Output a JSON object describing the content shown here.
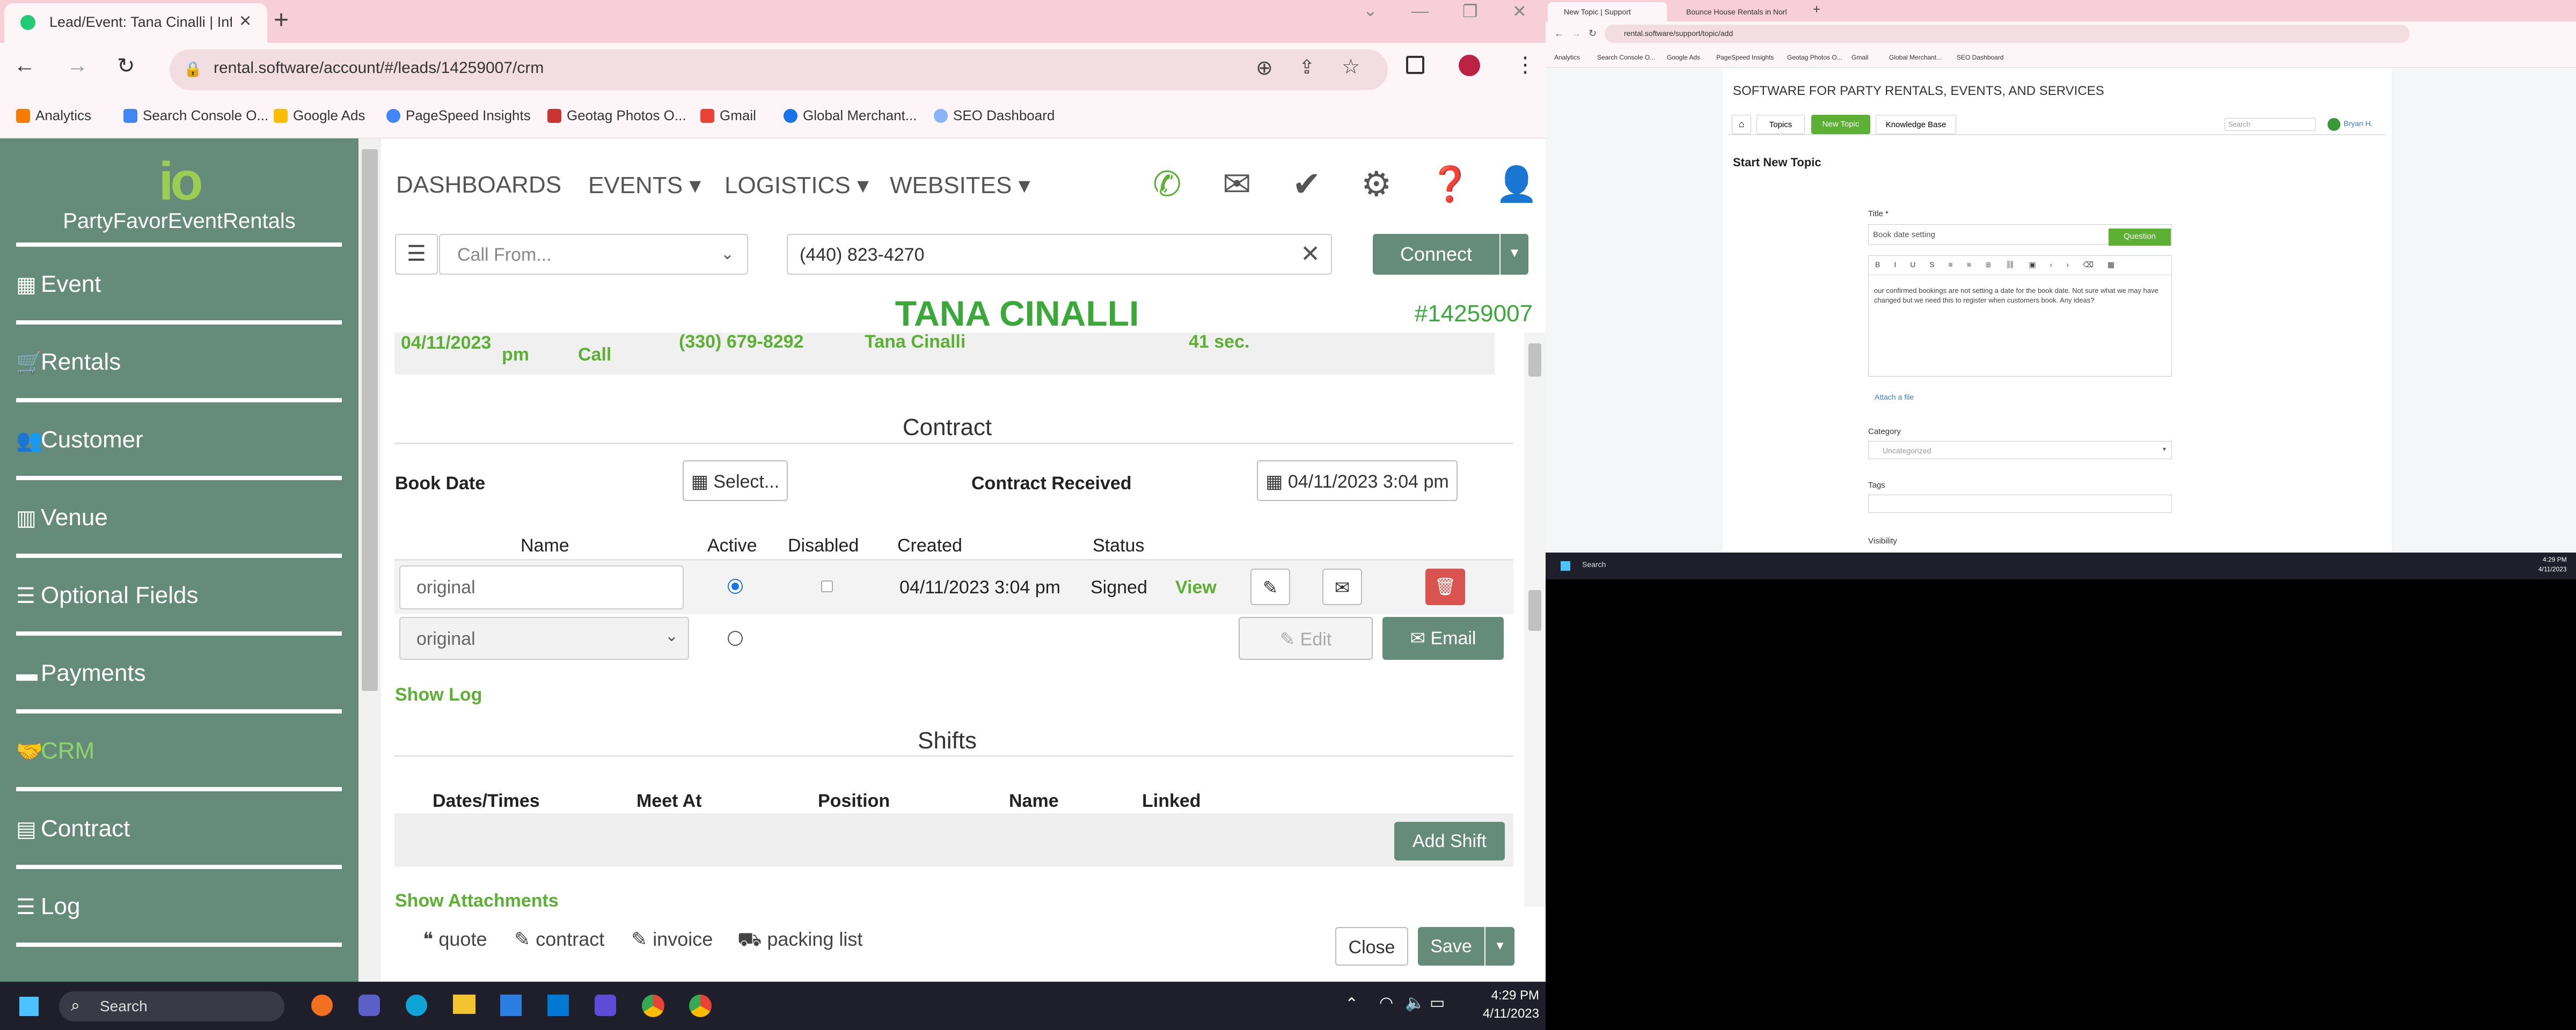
{
  "left_browser": {
    "tab_title": "Lead/Event: Tana Cinalli | Inflat",
    "url": "rental.software/account/#/leads/14259007/crm",
    "bookmarks": [
      "Analytics",
      "Search Console O...",
      "Google Ads",
      "PageSpeed Insights",
      "Geotag Photos O...",
      "Gmail",
      "Global Merchant...",
      "SEO Dashboard"
    ]
  },
  "app": {
    "logo_mark": "io",
    "company": "PartyFavorEventRentals",
    "sidebar": [
      {
        "icon": "calendar-icon",
        "glyph": "▦",
        "label": "Event"
      },
      {
        "icon": "cart-icon",
        "glyph": "🛒",
        "label": "Rentals"
      },
      {
        "icon": "users-icon",
        "glyph": "👥",
        "label": "Customer"
      },
      {
        "icon": "building-icon",
        "glyph": "▥",
        "label": "Venue"
      },
      {
        "icon": "list-icon",
        "glyph": "☰",
        "label": "Optional Fields"
      },
      {
        "icon": "money-icon",
        "glyph": "▬",
        "label": "Payments"
      },
      {
        "icon": "handshake-icon",
        "glyph": "🤝",
        "label": "CRM"
      },
      {
        "icon": "file-icon",
        "glyph": "▤",
        "label": "Contract"
      },
      {
        "icon": "list-icon",
        "glyph": "☰",
        "label": "Log"
      }
    ],
    "nav": [
      "DASHBOARDS",
      "EVENTS ▾",
      "LOGISTICS ▾",
      "WEBSITES ▾"
    ],
    "call": {
      "from_placeholder": "Call From...",
      "number": "(440) 823-4270",
      "connect": "Connect"
    },
    "customer_name": "TANA CINALLI",
    "lead_id": "#14259007",
    "log_row": {
      "date": "04/11/2023",
      "time": "pm",
      "type": "Call",
      "phone": "(330) 679-8292",
      "who": "Tana Cinalli",
      "duration": "41 sec."
    },
    "contract": {
      "heading": "Contract",
      "book_date_label": "Book Date",
      "select_btn": "Select...",
      "received_label": "Contract Received",
      "received_value": "04/11/2023 3:04 pm",
      "columns": [
        "Name",
        "Active",
        "Disabled",
        "Created",
        "Status"
      ],
      "row": {
        "name": "original",
        "created": "04/11/2023 3:04 pm",
        "status": "Signed",
        "view": "View"
      },
      "new_row": {
        "template": "original",
        "edit": "Edit",
        "email": "Email"
      },
      "show_log": "Show Log"
    },
    "shifts": {
      "heading": "Shifts",
      "columns": [
        "Dates/Times",
        "Meet At",
        "Position",
        "Name",
        "Linked"
      ],
      "add": "Add Shift",
      "show_attachments": "Show Attachments"
    },
    "footer": {
      "links": [
        "quote",
        "contract",
        "invoice",
        "packing list"
      ],
      "close": "Close",
      "save": "Save"
    }
  },
  "taskbar": {
    "search": "Search",
    "time": "4:29 PM",
    "date": "4/11/2023"
  },
  "right_browser": {
    "tabs": [
      "New Topic | Support",
      "Bounce House Rentals in Norl"
    ],
    "url": "rental.software/support/topic/add",
    "bookmarks": [
      "Analytics",
      "Search Console O...",
      "Google Ads",
      "PageSpeed Insights",
      "Geotag Photos O...",
      "Gmail",
      "Global Merchant...",
      "SEO Dashboard"
    ],
    "site_title": "SOFTWARE FOR PARTY RENTALS, EVENTS, AND SERVICES",
    "nav": [
      "Topics",
      "New Topic",
      "Knowledge Base"
    ],
    "search_placeholder": "Search",
    "user": "Bryan H.",
    "page_title": "Start New Topic",
    "title_label": "Title *",
    "title_value": "Book date setting",
    "type_btn": "Question",
    "body": "our confirmed bookings are not setting a date for the book date. Not sure what we may have changed but we need this to register when customers book. Any ideas?",
    "attach": "Attach a file",
    "category_label": "Category",
    "category_value": "Uncategorized",
    "tags_label": "Tags",
    "visibility_label": "Visibility",
    "taskbar_search": "Search",
    "taskbar_time": "4:29 PM",
    "taskbar_date": "4/11/2023"
  }
}
